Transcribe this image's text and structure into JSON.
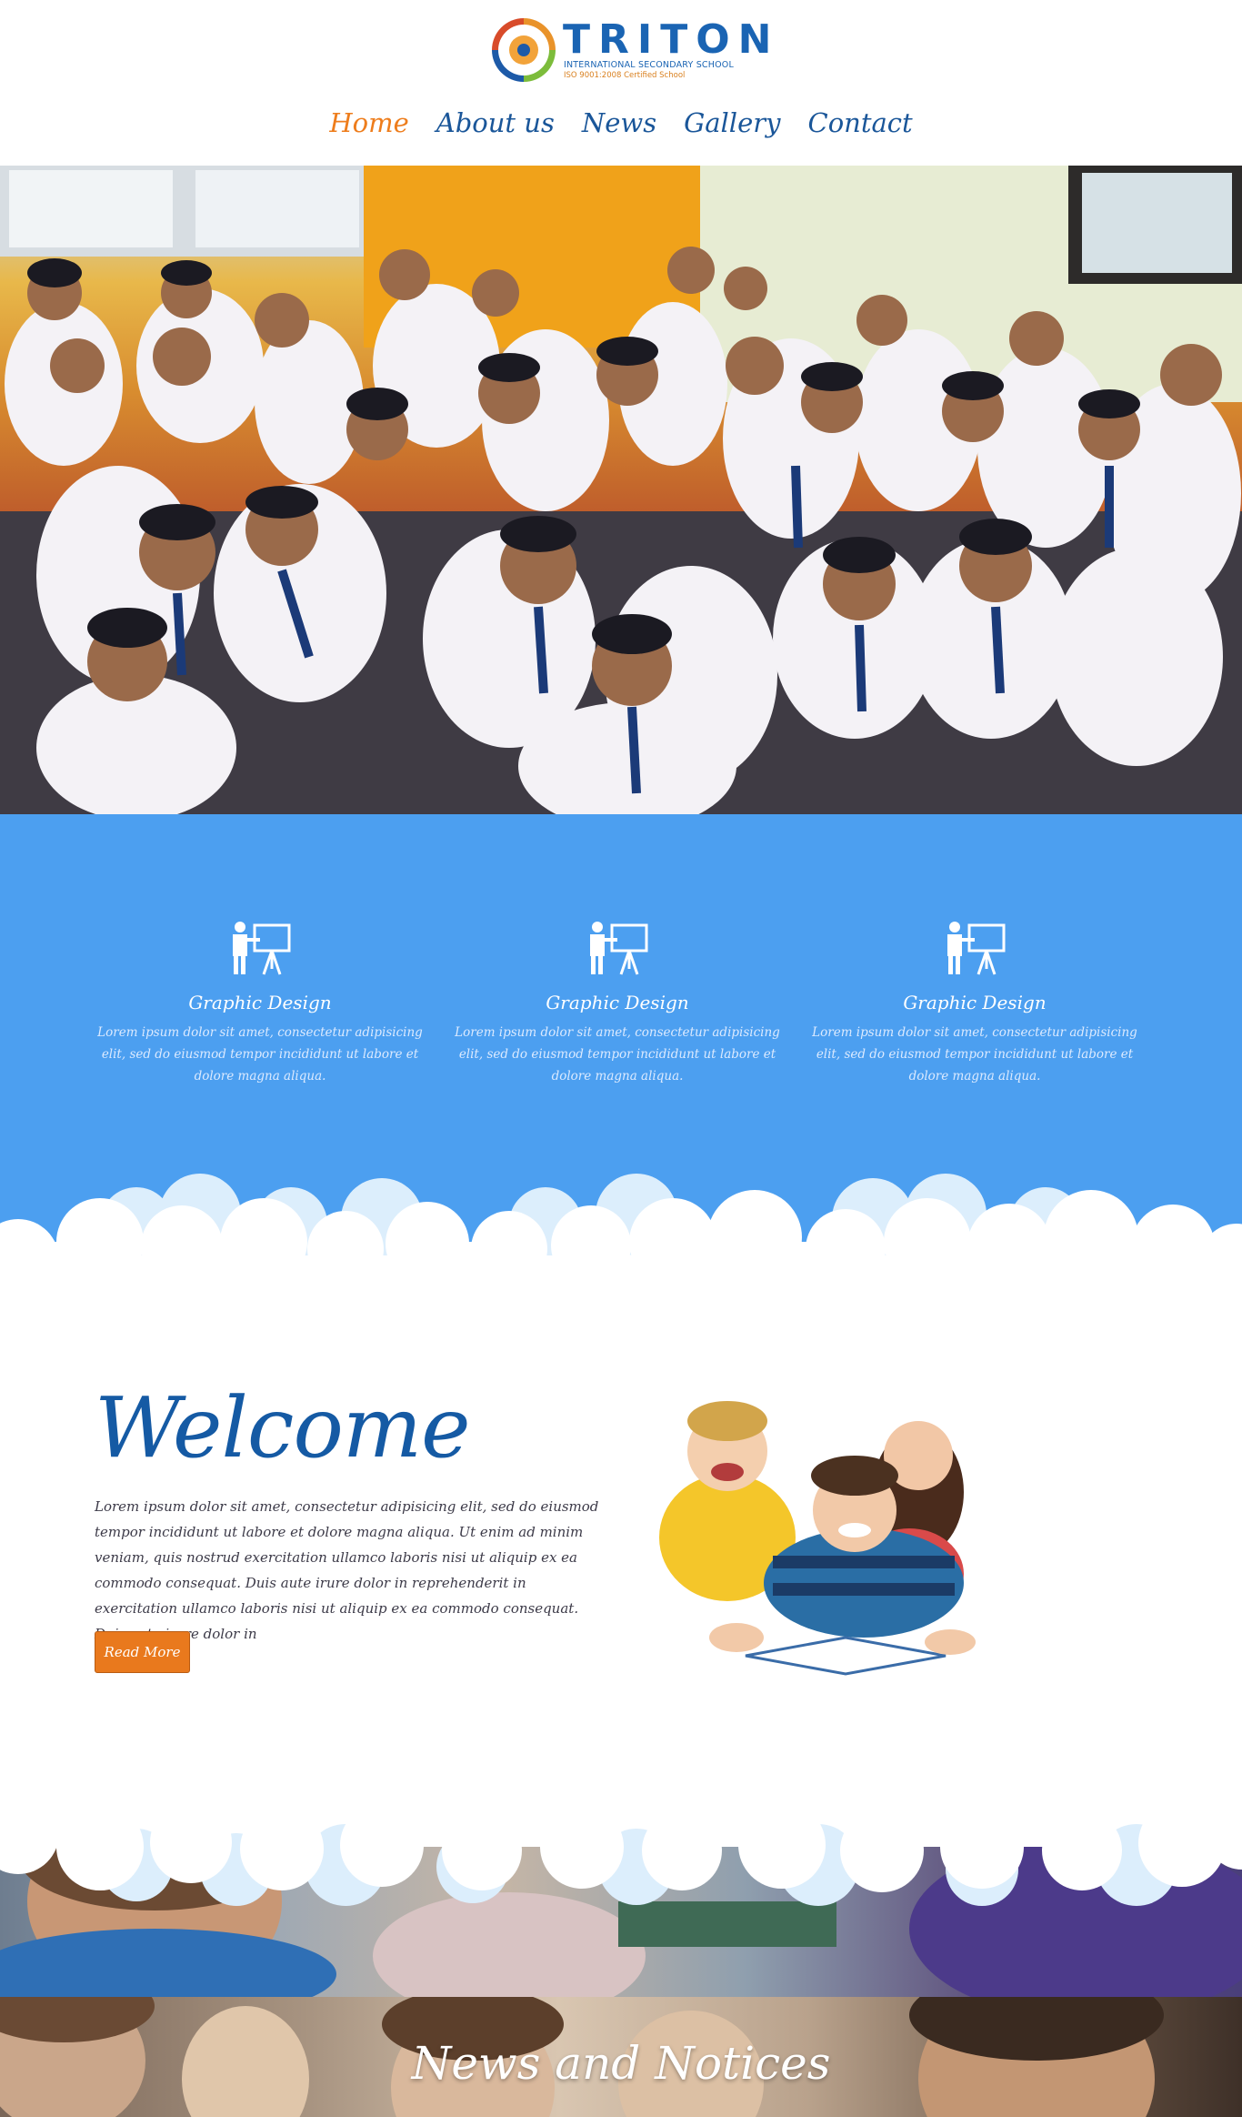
{
  "brand": {
    "name": "TRITON",
    "subtitle": "INTERNATIONAL SECONDARY SCHOOL",
    "certification": "ISO 9001:2008 Certified School"
  },
  "nav": {
    "items": [
      {
        "label": "Home",
        "active": true
      },
      {
        "label": "About us",
        "active": false
      },
      {
        "label": "News",
        "active": false
      },
      {
        "label": "Gallery",
        "active": false
      },
      {
        "label": "Contact",
        "active": false
      }
    ]
  },
  "colors": {
    "nav_active": "#ee7d1c",
    "nav_link": "#1a5699",
    "features_bg": "#4c9ff0",
    "welcome_title": "#155aa4",
    "button": "#e9791d"
  },
  "features": [
    {
      "icon": "teacher-board-icon",
      "title": "Graphic Design",
      "text": "Lorem ipsum dolor sit amet, consectetur adipisicing elit, sed do eiusmod tempor incididunt ut labore et dolore magna aliqua."
    },
    {
      "icon": "teacher-board-icon",
      "title": "Graphic Design",
      "text": "Lorem ipsum dolor sit amet, consectetur adipisicing elit, sed do eiusmod tempor incididunt ut labore et dolore magna aliqua."
    },
    {
      "icon": "teacher-board-icon",
      "title": "Graphic Design",
      "text": "Lorem ipsum dolor sit amet, consectetur adipisicing elit, sed do eiusmod tempor incididunt ut labore et dolore magna aliqua."
    }
  ],
  "welcome": {
    "title": "Welcome",
    "text": "Lorem ipsum dolor sit amet, consectetur adipisicing elit, sed do eiusmod tempor incididunt ut labore et dolore magna aliqua. Ut enim ad minim veniam, quis nostrud exercitation ullamco laboris nisi ut aliquip ex ea commodo consequat. Duis aute irure dolor in reprehenderit in exercitation ullamco laboris nisi ut aliquip ex ea commodo consequat. Duis aute irure dolor in",
    "button_label": "Read More"
  },
  "news": {
    "title": "News and Notices"
  }
}
